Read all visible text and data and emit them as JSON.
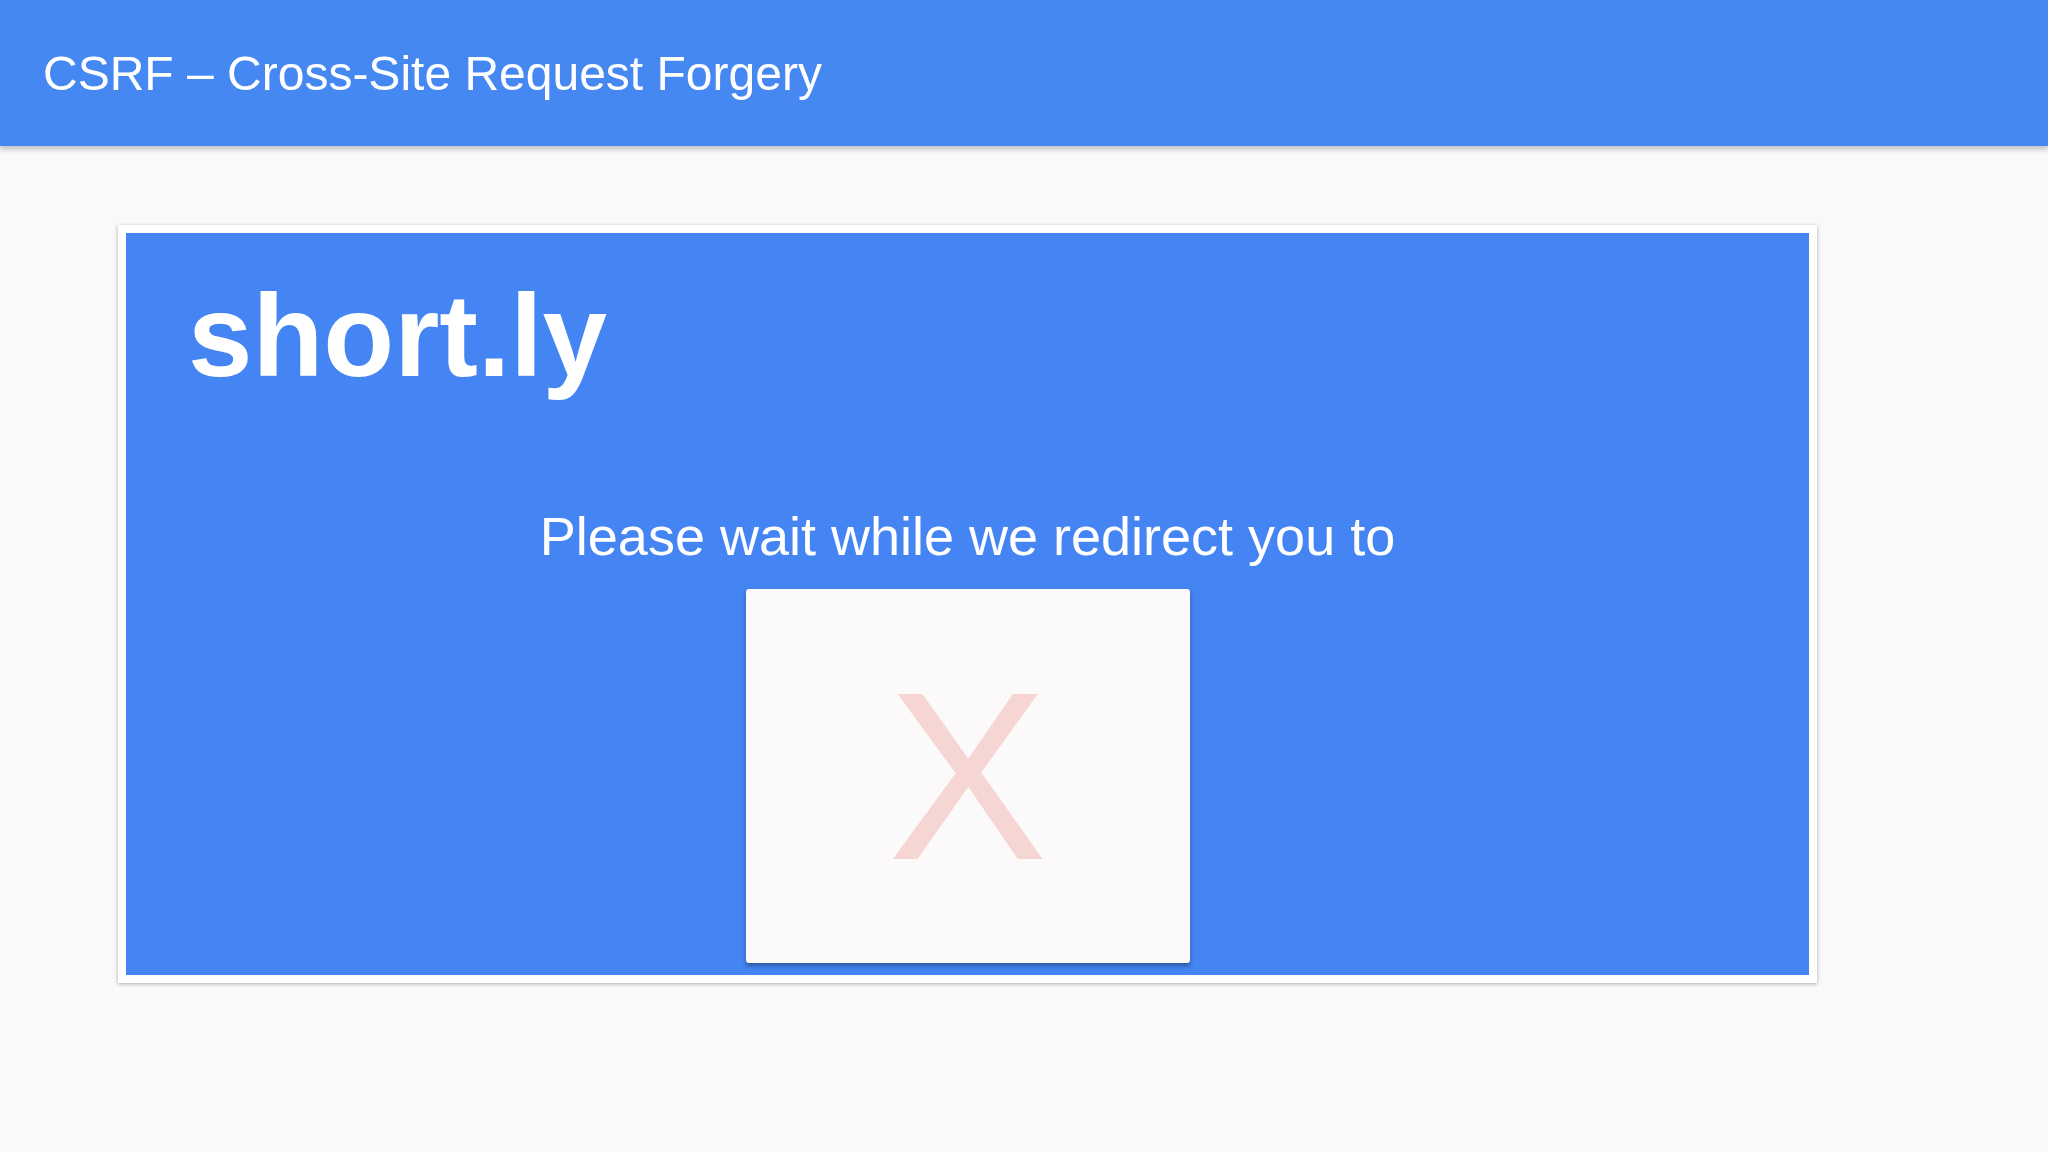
{
  "header": {
    "title": "CSRF – Cross-Site Request Forgery"
  },
  "site": {
    "logo": "short.ly",
    "message": "Please wait while we redirect you to",
    "target": {
      "mark": "X"
    }
  }
}
